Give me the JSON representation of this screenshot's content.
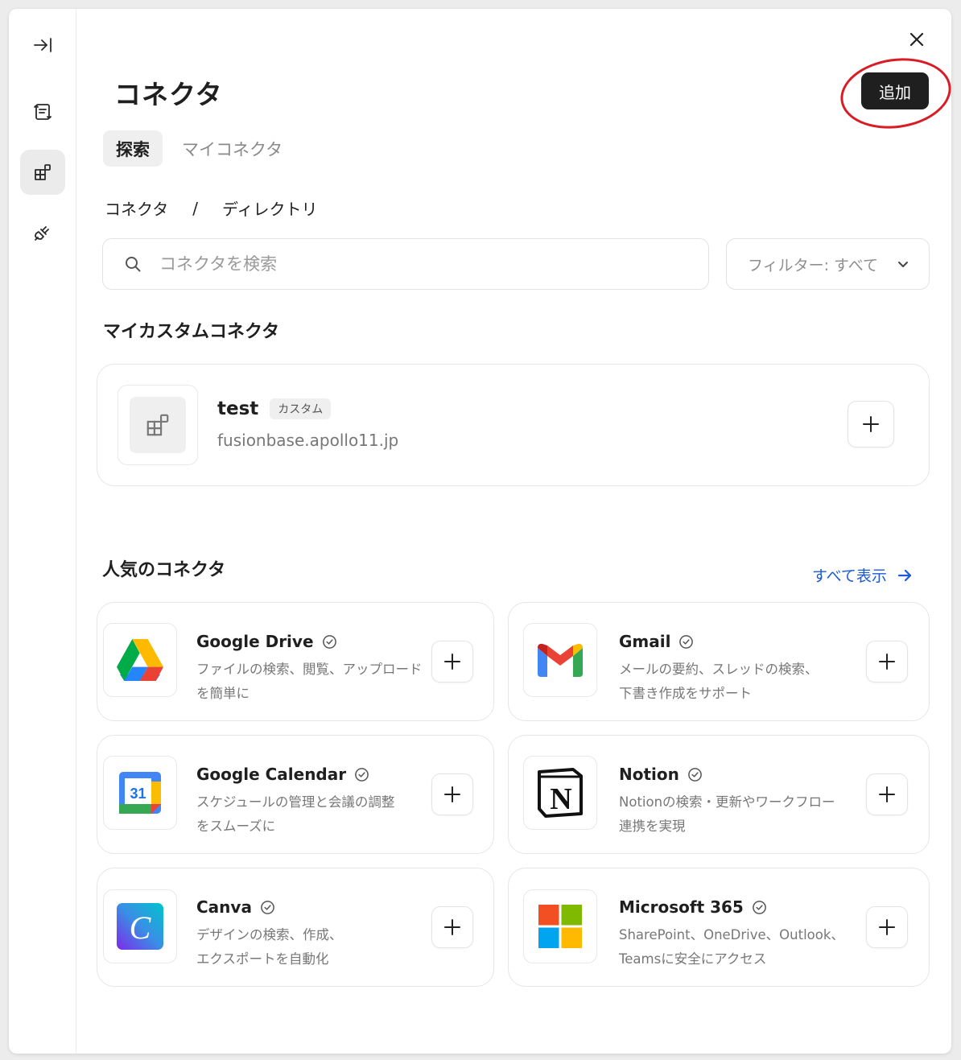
{
  "header": {
    "title": "コネクタ",
    "add_label": "追加"
  },
  "tabs": [
    {
      "label": "探索",
      "active": true
    },
    {
      "label": "マイコネクタ",
      "active": false
    }
  ],
  "breadcrumb": {
    "root": "コネクタ",
    "separator": "/",
    "current": "ディレクトリ"
  },
  "search": {
    "placeholder": "コネクタを検索",
    "value": ""
  },
  "filter": {
    "label": "フィルター: すべて"
  },
  "custom_section": {
    "title": "マイカスタムコネクタ",
    "item": {
      "name": "test",
      "badge": "カスタム",
      "url": "fusionbase.apollo11.jp"
    }
  },
  "popular_section": {
    "title": "人気のコネクタ",
    "view_all_label": "すべて表示",
    "items": [
      {
        "name": "Google Drive",
        "desc1": "ファイルの検索、閲覧、アップロード",
        "desc2": "を簡単に",
        "icon": "google-drive-logo"
      },
      {
        "name": "Gmail",
        "desc1": "メールの要約、スレッドの検索、",
        "desc2": "下書き作成をサポート",
        "icon": "gmail-logo"
      },
      {
        "name": "Google Calendar",
        "desc1": "スケジュールの管理と会議の調整",
        "desc2": "をスムーズに",
        "icon": "google-calendar-logo",
        "calendar_day": "31"
      },
      {
        "name": "Notion",
        "desc1": "Notionの検索・更新やワークフロー",
        "desc2": "連携を実現",
        "icon": "notion-logo",
        "logo_letter": "N"
      },
      {
        "name": "Canva",
        "desc1": "デザインの検索、作成、",
        "desc2": "エクスポートを自動化",
        "icon": "canva-logo",
        "logo_letter": "C"
      },
      {
        "name": "Microsoft 365",
        "desc1": "SharePoint、OneDrive、Outlook、",
        "desc2": "Teamsに安全にアクセス",
        "icon": "microsoft-logo"
      }
    ]
  },
  "colors": {
    "accent_link": "#1a5bd6",
    "annotation": "#d91c24",
    "primary_button": "#1f1f1f"
  }
}
